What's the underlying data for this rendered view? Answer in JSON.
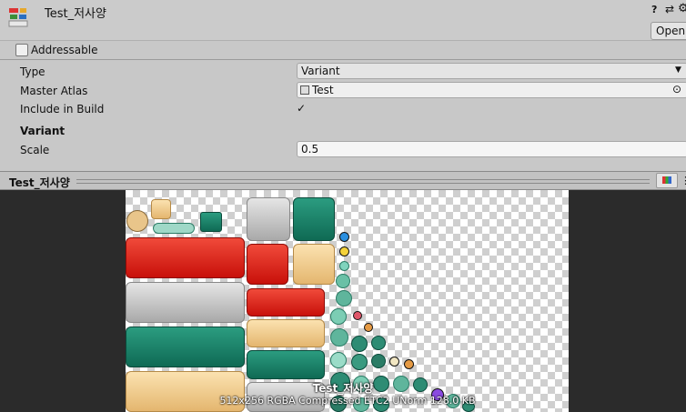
{
  "header": {
    "title": "Test_저사양",
    "help_icon": "?",
    "preset_icon": "⇄",
    "gear_icon": "⚙",
    "open_label": "Open"
  },
  "addressable": {
    "label": "Addressable",
    "checked": false
  },
  "properties": {
    "type_label": "Type",
    "type_value": "Variant",
    "master_atlas_label": "Master Atlas",
    "master_atlas_value": "Test",
    "include_label": "Include in Build",
    "include_checked": true,
    "variant_header": "Variant",
    "scale_label": "Scale",
    "scale_value": "0.5"
  },
  "preview": {
    "title": "Test_저사양",
    "name": "Test_저사양",
    "info": "512x256 RGBA Compressed ETC2 UNorm  128.0 KB"
  },
  "icons": {
    "asset": "sprite-atlas-icon",
    "atlas": "sprite-atlas-icon",
    "picker": "object-picker-icon",
    "channel": "rgb-channel-icon",
    "menu": "kebab-menu-icon"
  }
}
